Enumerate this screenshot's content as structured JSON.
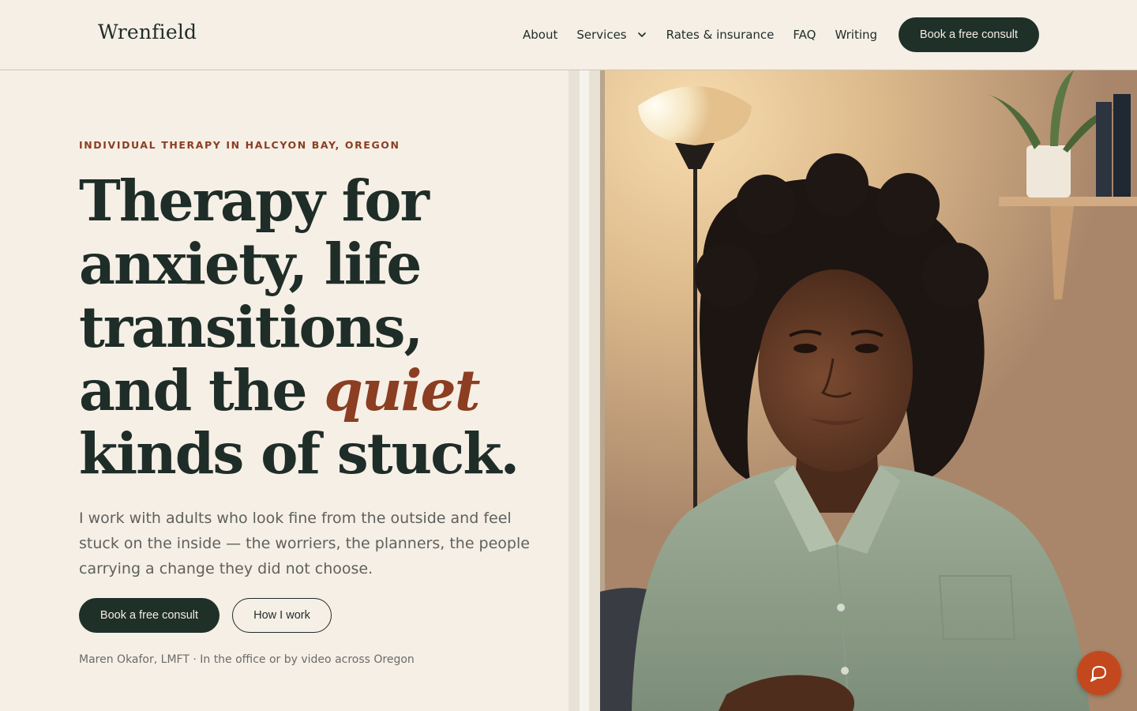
{
  "header": {
    "logo": "Wrenfield",
    "nav": [
      {
        "label": "About"
      },
      {
        "label": "Services",
        "has_dropdown": true
      },
      {
        "label": "Rates & insurance"
      },
      {
        "label": "FAQ"
      },
      {
        "label": "Writing"
      }
    ],
    "cta_label": "Book a free consult"
  },
  "hero": {
    "eyebrow": "INDIVIDUAL THERAPY IN HALCYON BAY, OREGON",
    "headline": {
      "line1": "Therapy for",
      "line2": "anxiety, life",
      "line3": "transitions,",
      "line4_before": "and the ",
      "line4_emphasis": "quiet",
      "line5": "kinds of stuck."
    },
    "lede": "I work with adults who look fine from the outside and feel stuck on the inside — the worriers, the planners, the people carrying a change they did not choose.",
    "primary_cta": "Book a free consult",
    "secondary_cta": "How I work",
    "byline": "Maren Okafor, LMFT · In the office or by video across Oregon"
  },
  "icons": {
    "services_dropdown": "chevron-down-icon",
    "chat": "chat-bubble-icon"
  },
  "colors": {
    "background": "#f6efe6",
    "ink": "#1f2d28",
    "accent": "#8b3e21",
    "button_dark": "#1f3029",
    "chat_button": "#c4481d"
  }
}
